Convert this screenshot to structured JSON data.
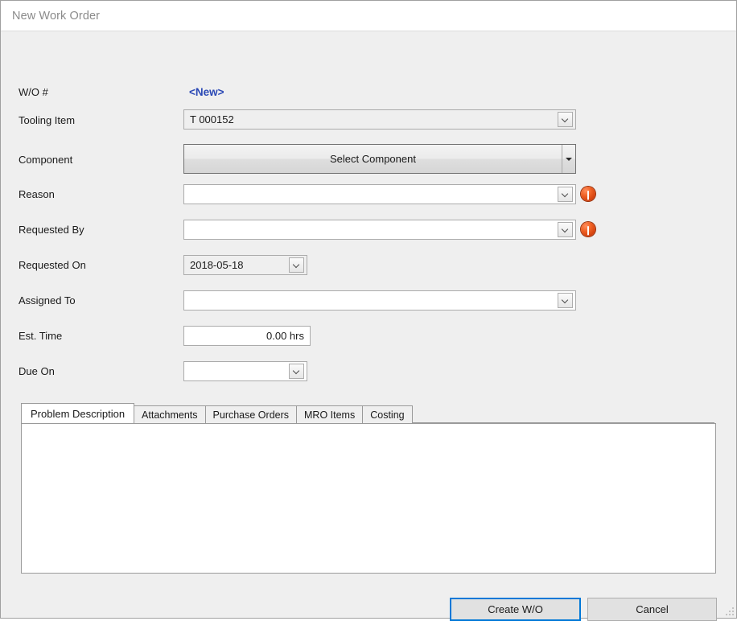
{
  "window": {
    "title": "New Work Order"
  },
  "form": {
    "rows": [
      {
        "label": "W/O #",
        "value": "<New>",
        "type": "static-link"
      },
      {
        "label": "Tooling Item",
        "value": "T 000152",
        "type": "combobox"
      },
      {
        "label": "Component",
        "value": "Select Component",
        "type": "split-button"
      },
      {
        "label": "Reason",
        "value": "",
        "type": "combobox",
        "error": true
      },
      {
        "label": "Requested By",
        "value": "",
        "type": "combobox",
        "error": true
      },
      {
        "label": "Requested On",
        "value": "2018-05-18",
        "type": "date-combobox"
      },
      {
        "label": "Assigned To",
        "value": "",
        "type": "combobox"
      },
      {
        "label": "Est. Time",
        "value": "0.00 hrs",
        "type": "textbox"
      },
      {
        "label": "Due On",
        "value": "",
        "type": "date-combobox"
      }
    ]
  },
  "tabs": {
    "items": [
      {
        "label": "Problem Description",
        "active": true
      },
      {
        "label": "Attachments",
        "active": false
      },
      {
        "label": "Purchase Orders",
        "active": false
      },
      {
        "label": "MRO Items",
        "active": false
      },
      {
        "label": "Costing",
        "active": false
      }
    ]
  },
  "editor": {
    "value": "",
    "placeholder": ""
  },
  "footer": {
    "create_label": "Create W/O",
    "cancel_label": "Cancel"
  },
  "icons": {
    "error": "error-icon",
    "dropdown": "chevron-down-icon",
    "split_arrow": "triangle-down-icon",
    "resize": "resize-grip-icon"
  },
  "colors": {
    "accent": "#0078d7",
    "link": "#2b49b5",
    "error": "#ef6124",
    "window_bg": "#efefef",
    "field_bg": "#ffffff"
  }
}
